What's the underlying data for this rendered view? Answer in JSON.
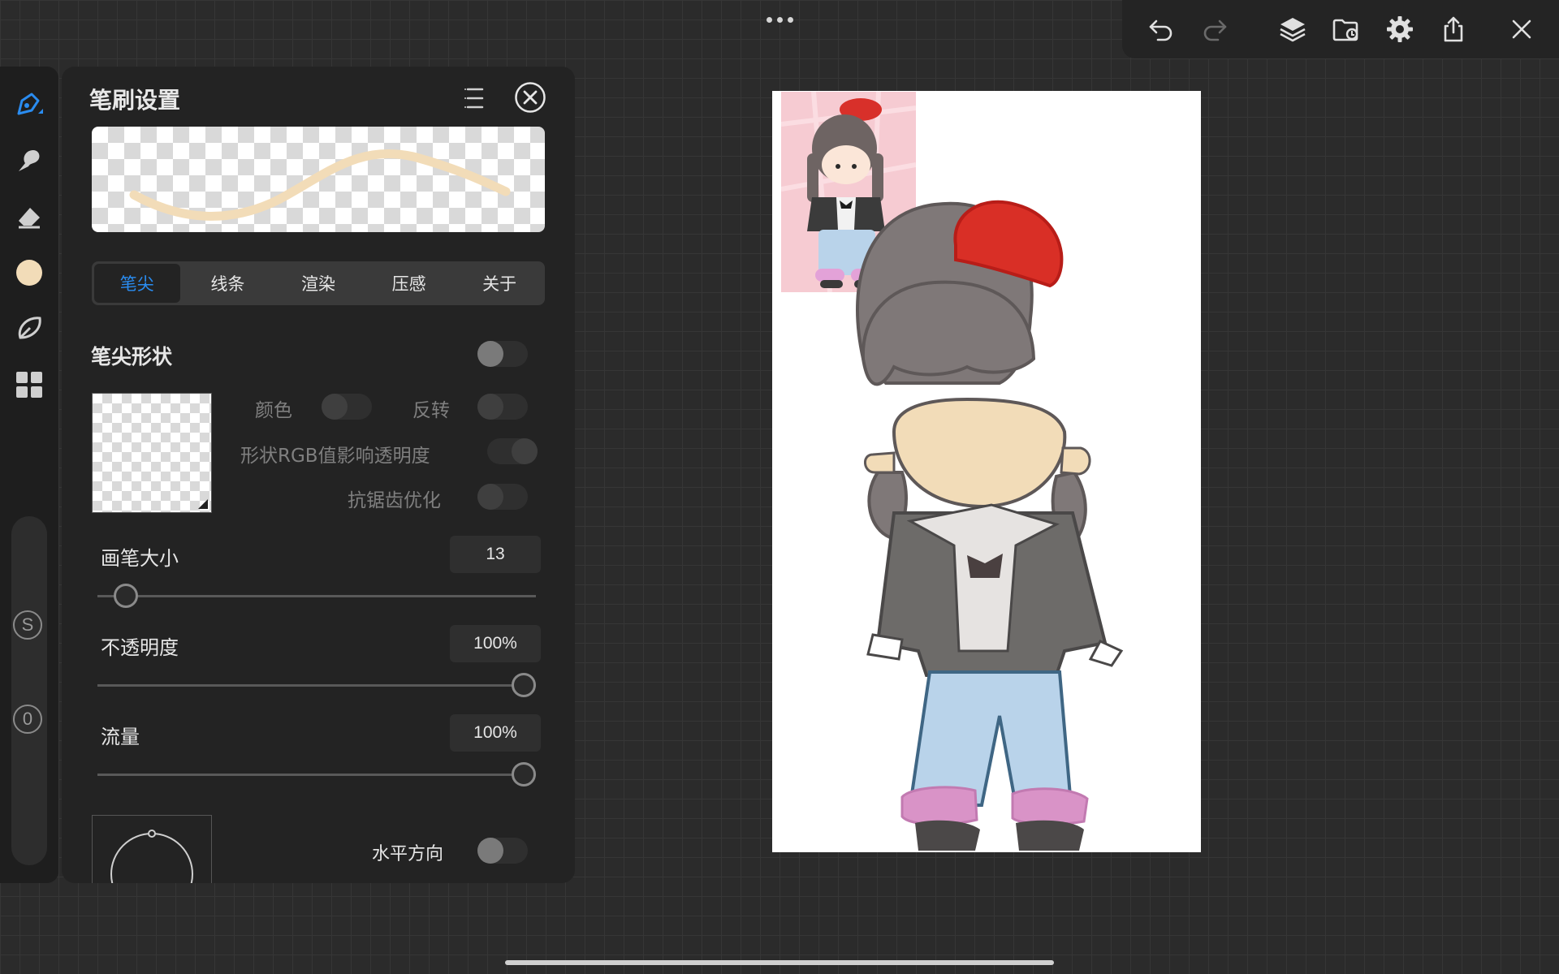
{
  "toolbar": {
    "buttons": [
      "undo-icon",
      "redo-icon",
      "layers-icon",
      "import-icon",
      "settings-icon",
      "share-icon",
      "close-icon"
    ]
  },
  "rail": {
    "tools": [
      "brush-icon",
      "smudge-icon",
      "eraser-icon",
      "color-swatch",
      "lasso-icon",
      "apps-icon"
    ],
    "current_color": "#f2dcb8",
    "accent_color": "#2a8cf0",
    "size_badge": "S",
    "opacity_badge": "0"
  },
  "panel": {
    "title": "笔刷设置",
    "tabs": [
      "笔尖",
      "线条",
      "渲染",
      "压感",
      "关于"
    ],
    "active_tab": 0,
    "tip_shape": {
      "label": "笔尖形状",
      "color_label": "颜色",
      "invert_label": "反转",
      "rgb_label": "形状RGB值影响透明度",
      "antialias_label": "抗锯齿优化"
    },
    "brush_size": {
      "label": "画笔大小",
      "value": "13",
      "fraction": 0.04
    },
    "opacity": {
      "label": "不透明度",
      "value": "100%",
      "fraction": 1.0
    },
    "flow": {
      "label": "流量",
      "value": "100%",
      "fraction": 1.0
    },
    "horizontal_label": "水平方向"
  }
}
